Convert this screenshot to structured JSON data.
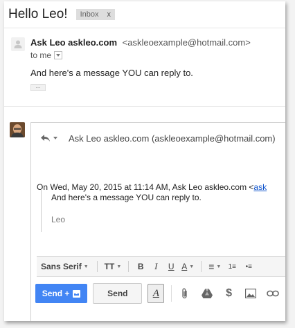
{
  "thread": {
    "subject": "Hello Leo!",
    "label": "Inbox",
    "label_remove": "x"
  },
  "message": {
    "sender_name": "Ask Leo askleo.com",
    "sender_email": "<askleoexample@hotmail.com>",
    "to_label": "to me",
    "body": "And here's a message YOU can reply to.",
    "show_trimmed": "..."
  },
  "reply": {
    "recipient": "Ask Leo askleo.com (askleoexample@hotmail.com)",
    "quote_intro": "On Wed, May 20, 2015 at 11:14 AM, Ask Leo askleo.com <",
    "quote_link": "ask",
    "quote_body": "And here's a message YOU can reply to.",
    "quote_signature": "Leo"
  },
  "toolbar": {
    "font": "Sans Serif",
    "size_glyph": "TT",
    "bold": "B",
    "italic": "I",
    "underline": "U",
    "text_color": "A",
    "align": "≡",
    "numbered_list": "1≡",
    "bulleted_list": "•≡"
  },
  "actions": {
    "send_plus": "Send +",
    "send": "Send",
    "format_options": "A"
  },
  "icons": [
    "person-icon",
    "reply-arrow-icon",
    "dropdown-icon",
    "attach-icon",
    "drive-icon",
    "dollar-icon",
    "photo-icon",
    "link-icon"
  ],
  "colors": {
    "send_blue": "#4285f4",
    "link_blue": "#1155cc"
  }
}
